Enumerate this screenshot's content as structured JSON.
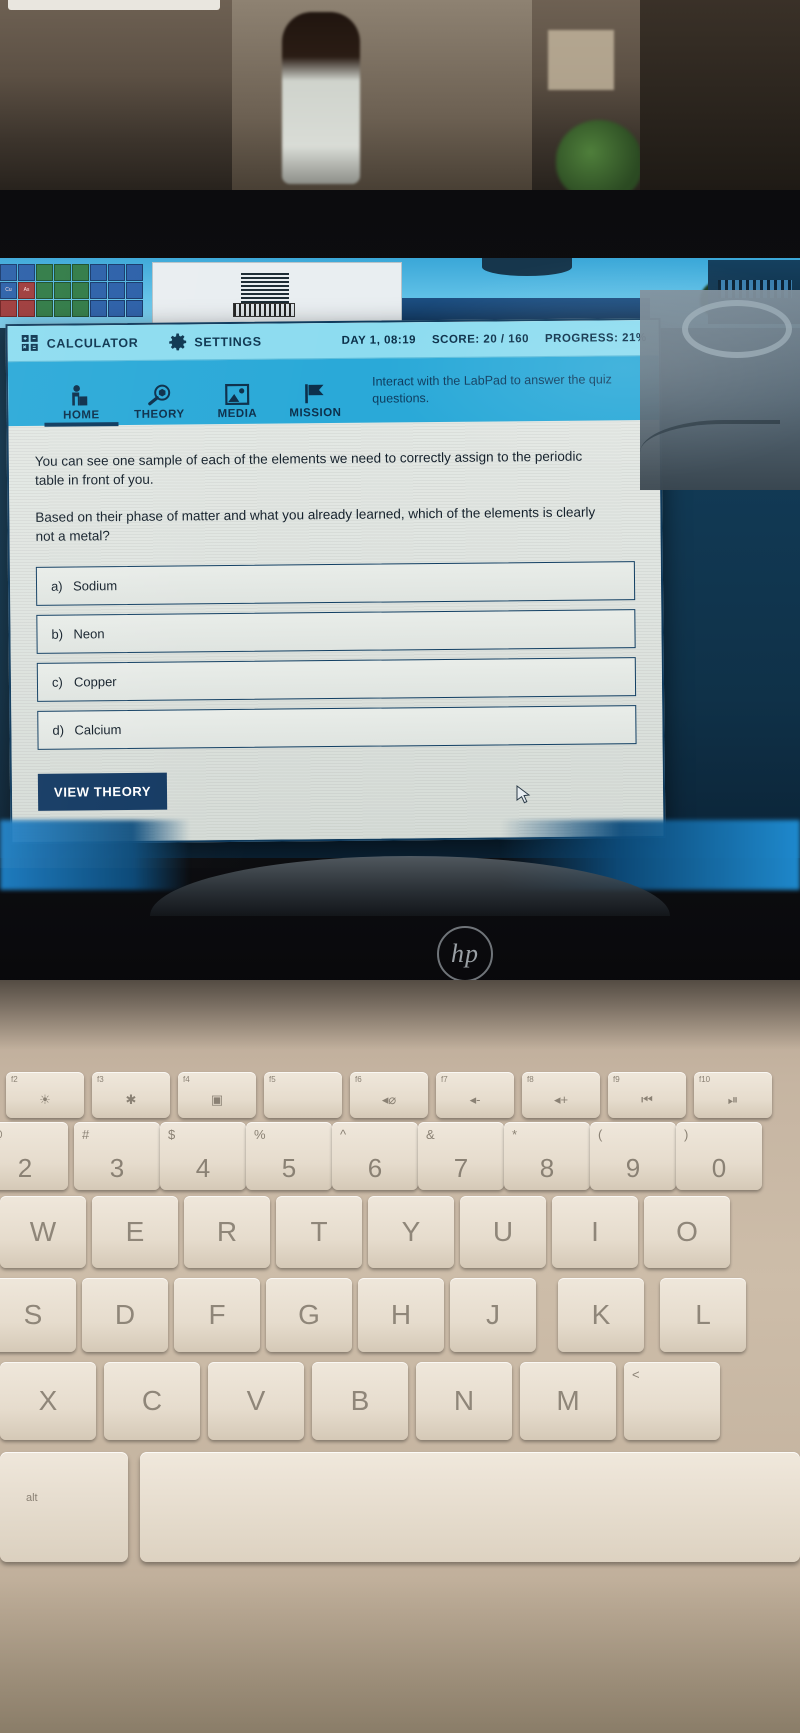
{
  "labpad": {
    "topbar": {
      "calculator_label": "CALCULATOR",
      "settings_label": "SETTINGS",
      "day_time": "DAY 1, 08:19",
      "score": "SCORE: 20 / 160",
      "progress": "PROGRESS: 21%"
    },
    "nav": {
      "tabs": [
        {
          "label": "HOME",
          "icon": "home-icon",
          "active": true
        },
        {
          "label": "THEORY",
          "icon": "magnifier-hexagon-icon",
          "active": false
        },
        {
          "label": "MEDIA",
          "icon": "image-icon",
          "active": false
        },
        {
          "label": "MISSION",
          "icon": "flag-icon",
          "active": false
        }
      ],
      "hint": "Interact with the LabPad to answer the quiz questions."
    },
    "content": {
      "paragraph_1": "You can see one sample of each of the elements we need to correctly assign to the periodic table in front of you.",
      "paragraph_2": "Based on their phase of matter and what you already learned, which of the elements is clearly not a metal?",
      "options": [
        {
          "key": "a)",
          "text": "Sodium"
        },
        {
          "key": "b)",
          "text": "Neon"
        },
        {
          "key": "c)",
          "text": "Copper"
        },
        {
          "key": "d)",
          "text": "Calcium"
        }
      ],
      "view_theory_label": "VIEW THEORY"
    },
    "colors": {
      "topbar_bg": "#8ddcf0",
      "nav_bg": "#2aa9d8",
      "panel_border": "#0f3a5c",
      "button_bg": "#143a63",
      "text_dark": "#14202b"
    }
  },
  "laptop": {
    "brand_logo": "hp",
    "keyboard": {
      "fn_row": [
        {
          "sup": "f2",
          "glyph": "☀"
        },
        {
          "sup": "f3",
          "glyph": "✱"
        },
        {
          "sup": "f4",
          "glyph": "▣"
        },
        {
          "sup": "f5",
          "glyph": ""
        },
        {
          "sup": "f6",
          "glyph": "◂⌀"
        },
        {
          "sup": "f7",
          "glyph": "◂-"
        },
        {
          "sup": "f8",
          "glyph": "◂+"
        },
        {
          "sup": "f9",
          "glyph": "⏮"
        },
        {
          "sup": "f10",
          "glyph": "⏯"
        }
      ],
      "number_row": [
        {
          "sup": "@",
          "main": "2"
        },
        {
          "sup": "#",
          "main": "3"
        },
        {
          "sup": "$",
          "main": "4"
        },
        {
          "sup": "%",
          "main": "5"
        },
        {
          "sup": "^",
          "main": "6"
        },
        {
          "sup": "&",
          "main": "7"
        },
        {
          "sup": "*",
          "main": "8"
        },
        {
          "sup": "(",
          "main": "9"
        },
        {
          "sup": ")",
          "main": "0"
        }
      ],
      "row_q": [
        "W",
        "E",
        "R",
        "T",
        "Y",
        "U",
        "I",
        "O"
      ],
      "row_a": [
        "S",
        "D",
        "F",
        "G",
        "H",
        "J",
        "K",
        "L"
      ],
      "row_z": [
        "X",
        "C",
        "V",
        "B",
        "N",
        "M",
        "<"
      ],
      "alt_label": "alt"
    }
  }
}
